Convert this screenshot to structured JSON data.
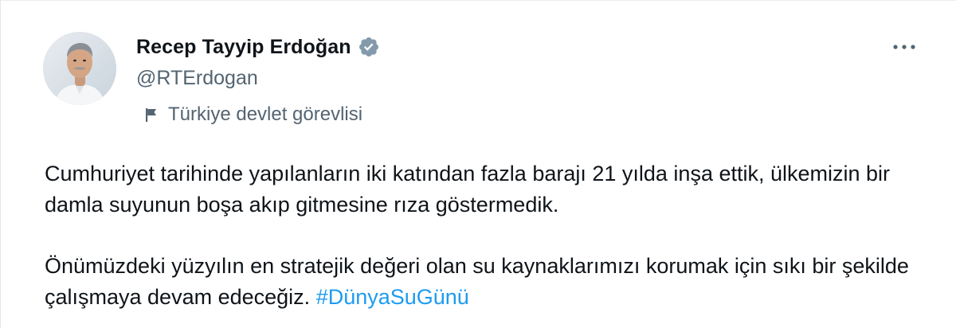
{
  "tweet": {
    "author": {
      "display_name": "Recep Tayyip Erdoğan",
      "handle": "@RTErdogan",
      "verified": true,
      "verified_icon": "verified-badge-icon",
      "label": "Türkiye devlet görevlisi",
      "label_icon": "flag-icon"
    },
    "more_icon": "more-options-icon",
    "body": {
      "paragraph1": "Cumhuriyet tarihinde yapılanların iki katından fazla barajı 21 yılda inşa ettik, ülkemizin bir damla suyunun boşa akıp gitmesine rıza göstermedik.",
      "paragraph2_text": "Önümüzdeki yüzyılın en stratejik değeri olan su kaynaklarımızı korumak için sıkı bir şekilde çalışmaya devam edeceğiz.",
      "hashtag": "#DünyaSuGünü"
    }
  },
  "colors": {
    "text": "#0f1419",
    "secondary": "#536471",
    "link": "#1d9bf0",
    "verified_badge": "#829aab"
  }
}
